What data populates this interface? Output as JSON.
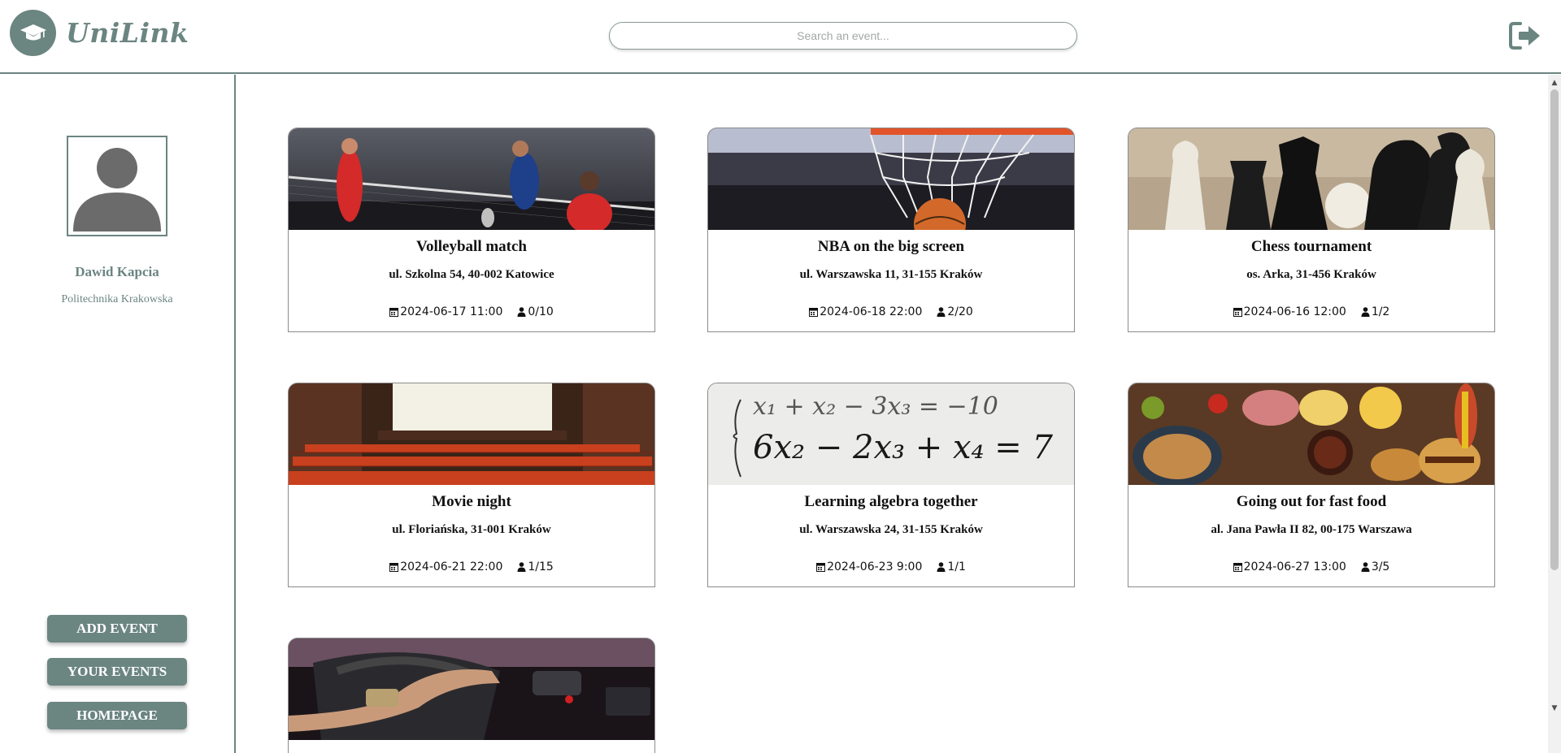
{
  "header": {
    "app_name": "UniLink",
    "search_placeholder": "Search an event..."
  },
  "user": {
    "name": "Dawid Kapcia",
    "university": "Politechnika Krakowska"
  },
  "sidebar": {
    "buttons": [
      "ADD EVENT",
      "YOUR EVENTS",
      "HOMEPAGE"
    ]
  },
  "events": [
    {
      "title": "Volleyball match",
      "address": "ul. Szkolna 54, 40-002 Katowice",
      "datetime": "2024-06-17 11:00",
      "participants": "0/10",
      "image": "volleyball-players-photo"
    },
    {
      "title": "NBA on the big screen",
      "address": "ul. Warszawska 11, 31-155 Kraków",
      "datetime": "2024-06-18 22:00",
      "participants": "2/20",
      "image": "basketball-net-photo"
    },
    {
      "title": "Chess tournament",
      "address": "os. Arka, 31-456 Kraków",
      "datetime": "2024-06-16 12:00",
      "participants": "1/2",
      "image": "chess-pieces-photo"
    },
    {
      "title": "Movie night",
      "address": "ul. Floriańska, 31-001 Kraków",
      "datetime": "2024-06-21 22:00",
      "participants": "1/15",
      "image": "cinema-hall-photo"
    },
    {
      "title": "Learning algebra together",
      "address": "ul. Warszawska 24, 31-155 Kraków",
      "datetime": "2024-06-23 9:00",
      "participants": "1/1",
      "image": "algebra-equations-photo"
    },
    {
      "title": "Going out for fast food",
      "address": "al. Jana Pawła II 82, 00-175 Warszawa",
      "datetime": "2024-06-27 13:00",
      "participants": "3/5",
      "image": "fast-food-table-photo"
    },
    {
      "title": "",
      "address": "",
      "datetime": "",
      "participants": "",
      "image": "car-steering-wheel-photo"
    }
  ],
  "icons": {
    "logo": "graduation-cap-icon",
    "logout": "logout-icon",
    "date": "calendar-icon",
    "participants": "person-icon"
  },
  "colors": {
    "accent": "#6b8581",
    "text": "#111111",
    "card_border": "#8b8b8b"
  }
}
